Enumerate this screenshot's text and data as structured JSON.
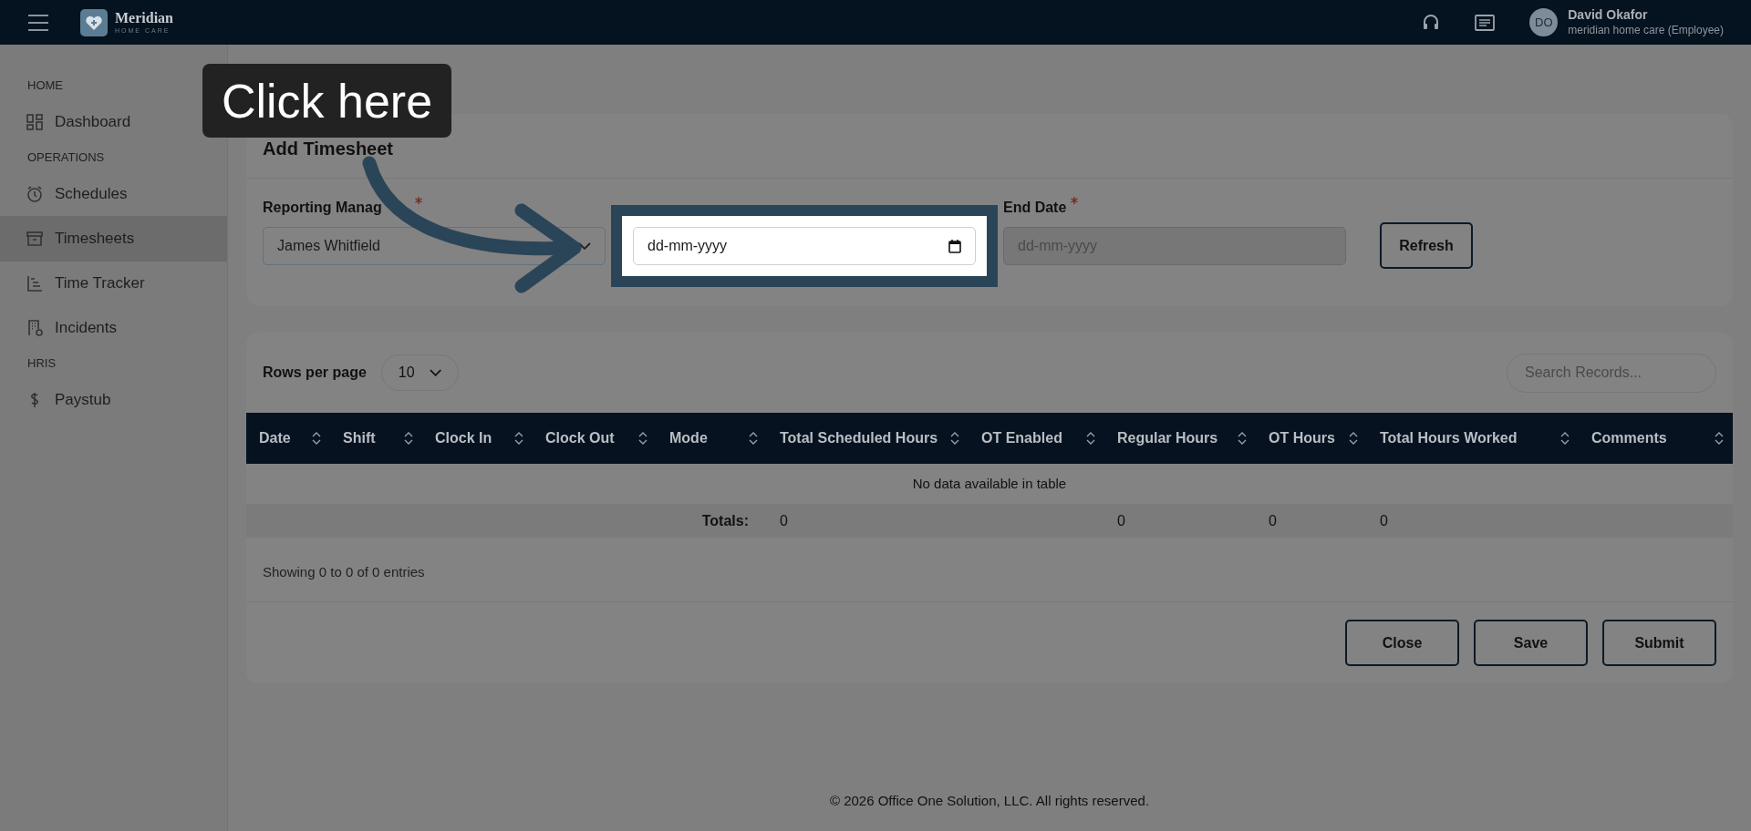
{
  "topbar": {
    "brand": "Meridian",
    "tagline": "HOME CARE",
    "user": {
      "initials": "DO",
      "name": "David Okafor",
      "role": "meridian home care (Employee)"
    }
  },
  "sidebar": {
    "sections": [
      {
        "heading": "HOME",
        "items": [
          {
            "label": "Dashboard",
            "selected": false
          }
        ]
      },
      {
        "heading": "OPERATIONS",
        "items": [
          {
            "label": "Schedules",
            "selected": false
          },
          {
            "label": "Timesheets",
            "selected": true
          },
          {
            "label": "Time Tracker",
            "selected": false
          },
          {
            "label": "Incidents",
            "selected": false
          }
        ]
      },
      {
        "heading": "HRIS",
        "items": [
          {
            "label": "Paystub",
            "selected": false
          }
        ]
      }
    ]
  },
  "form": {
    "title": "Add Timesheet",
    "fields": [
      {
        "kind": "select",
        "label": "Reporting Manag",
        "required": true,
        "value": "James Whitfield",
        "disabled": false,
        "highlighted": false
      },
      {
        "kind": "date",
        "placeholder": "dd-mm-yyyy",
        "disabled": false,
        "highlighted": true
      },
      {
        "kind": "date",
        "label": "End Date",
        "required": true,
        "placeholder": "dd-mm-yyyy",
        "disabled": true,
        "highlighted": false
      }
    ],
    "refresh_button": "Refresh"
  },
  "table": {
    "rows_per_page_label": "Rows per page",
    "rows_per_page": "10",
    "search_placeholder": "Search Records...",
    "columns": [
      "Date",
      "Shift",
      "Clock In",
      "Clock Out",
      "Mode",
      "Total Scheduled Hours",
      "OT Enabled",
      "Regular Hours",
      "OT Hours",
      "Total Hours Worked",
      "Comments"
    ],
    "empty_message": "No data available in table",
    "totals_label": "Totals:",
    "totals": [
      "0",
      "0",
      "0",
      "0"
    ],
    "info": "Showing 0 to 0 of 0 entries",
    "buttons": [
      "Close",
      "Save",
      "Submit"
    ]
  },
  "tutorial": {
    "callout": "Click here"
  },
  "footer": "© 2026 Office One Solution, LLC. All rights reserved."
}
